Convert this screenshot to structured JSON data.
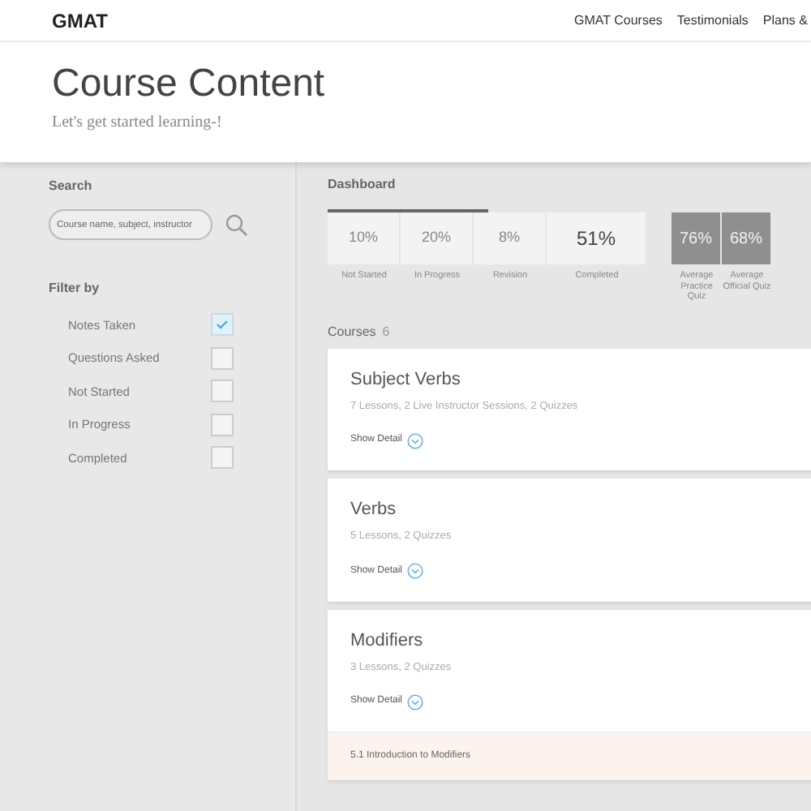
{
  "navbar": {
    "brand": "GMAT",
    "links": [
      "GMAT Courses",
      "Testimonials",
      "Plans &"
    ]
  },
  "header": {
    "title": "Course Content",
    "subtitle": "Let's get started learning-!"
  },
  "sidebar": {
    "search_label": "Search",
    "search": {
      "placeholder": "Course name, subject, instructor"
    },
    "filter_label": "Filter by",
    "filters": [
      {
        "label": "Notes Taken",
        "checked": true
      },
      {
        "label": "Questions Asked",
        "checked": false
      },
      {
        "label": "Not Started",
        "checked": false
      },
      {
        "label": "In Progress",
        "checked": false
      },
      {
        "label": "Completed",
        "checked": false
      }
    ]
  },
  "dashboard": {
    "title": "Dashboard",
    "stats": [
      {
        "kind": "light",
        "value": "10%",
        "label": "Not Started"
      },
      {
        "kind": "light",
        "value": "20%",
        "label": "In Progress"
      },
      {
        "kind": "light",
        "value": "8%",
        "label": "Revision"
      },
      {
        "kind": "big",
        "value": "51%",
        "label": "Completed"
      },
      {
        "kind": "dark",
        "value": "76%",
        "label": "Average Practice Quiz"
      },
      {
        "kind": "dark",
        "value": "68%",
        "label": "Average Official Quiz"
      }
    ]
  },
  "courses": {
    "title": "Courses",
    "count": "6",
    "items": [
      {
        "title": "Subject Verbs",
        "summary": "7 Lessons, 2 Live Instructor Sessions, 2 Quizzes",
        "toggle": "Show Detail"
      },
      {
        "title": "Verbs",
        "summary": "5 Lessons, 2 Quizzes",
        "toggle": "Show Detail"
      },
      {
        "title": "Modifiers",
        "summary": "3 Lessons, 2 Quizzes",
        "toggle": "Show Detail",
        "lessons": [
          "5.1 Introduction to Modifiers"
        ]
      }
    ]
  }
}
